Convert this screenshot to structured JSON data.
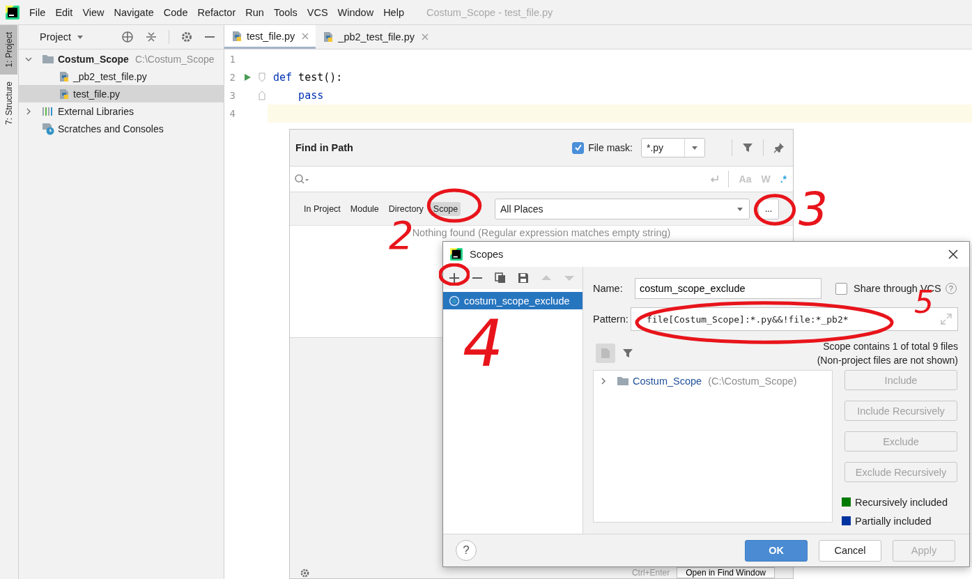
{
  "window": {
    "title": "Costum_Scope - test_file.py"
  },
  "menu": [
    "File",
    "Edit",
    "View",
    "Navigate",
    "Code",
    "Refactor",
    "Run",
    "Tools",
    "VCS",
    "Window",
    "Help"
  ],
  "tool_strip": [
    {
      "label": "1: Project",
      "selected": true
    },
    {
      "label": "7: Structure",
      "selected": false
    }
  ],
  "project_panel": {
    "title": "Project",
    "tree": [
      {
        "label": "Costum_Scope",
        "path": "C:\\Costum_Scope",
        "kind": "folder",
        "bold": true,
        "expanded": true,
        "selected": false,
        "children": [
          {
            "label": "_pb2_test_file.py",
            "kind": "python",
            "selected": false
          },
          {
            "label": "test_file.py",
            "kind": "python",
            "selected": true
          }
        ]
      },
      {
        "label": "External Libraries",
        "kind": "library",
        "expanded": false,
        "selected": false
      },
      {
        "label": "Scratches and Consoles",
        "kind": "scratches",
        "selected": false
      }
    ]
  },
  "editor": {
    "tabs": [
      {
        "label": "test_file.py",
        "selected": true
      },
      {
        "label": "_pb2_test_file.py",
        "selected": false
      }
    ],
    "lines": [
      {
        "number": "1"
      },
      {
        "number": "2",
        "run_marker": true,
        "fold_start": true,
        "tokens": [
          {
            "text": "def",
            "kind": "keyword"
          },
          {
            "text": " test():",
            "kind": "plain"
          }
        ]
      },
      {
        "number": "3",
        "fold_end": true,
        "tokens": [
          {
            "text": "    pass",
            "kind": "keyword"
          }
        ]
      },
      {
        "number": "4",
        "current": true
      }
    ]
  },
  "find_popup": {
    "title": "Find in Path",
    "file_mask": {
      "label": "File mask:",
      "checked": true,
      "value": "*.py"
    },
    "options": [
      {
        "label": "Aa",
        "on": false
      },
      {
        "label": "W",
        "on": false
      },
      {
        "label": ".*",
        "on": true
      }
    ],
    "scope_tabs": [
      {
        "label": "In Project",
        "selected": false
      },
      {
        "label": "Module",
        "selected": false
      },
      {
        "label": "Directory",
        "selected": false
      },
      {
        "label": "Scope",
        "selected": true
      }
    ],
    "scope_value": "All Places",
    "browse_button": "...",
    "message": "Nothing found (Regular expression matches empty string)",
    "shortcut": "Ctrl+Enter",
    "open_button": "Open in Find Window"
  },
  "scopes_dialog": {
    "title": "Scopes",
    "scopes": [
      {
        "name": "costum_scope_exclude",
        "selected": true
      }
    ],
    "name_label": "Name:",
    "name_value": "costum_scope_exclude",
    "share": {
      "label": "Share through VCS",
      "checked": false,
      "help": "?"
    },
    "pattern_label": "Pattern:",
    "pattern_value": "file[Costum_Scope]:*.py&&!file:*_pb2*",
    "info": [
      "Scope contains 1 of total 9 files",
      "(Non-project files are not shown)"
    ],
    "tree": [
      {
        "label": "Costum_Scope",
        "path": "(C:\\Costum_Scope)",
        "expanded": false
      }
    ],
    "side_buttons": [
      {
        "label": "Include",
        "disabled": true
      },
      {
        "label": "Include Recursively",
        "disabled": true
      },
      {
        "label": "Exclude",
        "disabled": true
      },
      {
        "label": "Exclude Recursively",
        "disabled": true
      }
    ],
    "legend": [
      {
        "label": "Recursively included",
        "color": "#007a00"
      },
      {
        "label": "Partially included",
        "color": "#0033a0"
      }
    ],
    "help": "?",
    "footer_buttons": [
      {
        "label": "OK",
        "kind": "primary",
        "disabled": false
      },
      {
        "label": "Cancel",
        "kind": "normal",
        "disabled": false
      },
      {
        "label": "Apply",
        "kind": "normal",
        "disabled": true
      }
    ]
  },
  "marks": [
    {
      "kind": "circle"
    },
    {
      "kind": "number",
      "label": "2"
    },
    {
      "kind": "circle"
    },
    {
      "kind": "number",
      "label": "3"
    },
    {
      "kind": "circle"
    },
    {
      "kind": "number",
      "label": "4"
    },
    {
      "kind": "circle"
    },
    {
      "kind": "number",
      "label": "5"
    }
  ]
}
